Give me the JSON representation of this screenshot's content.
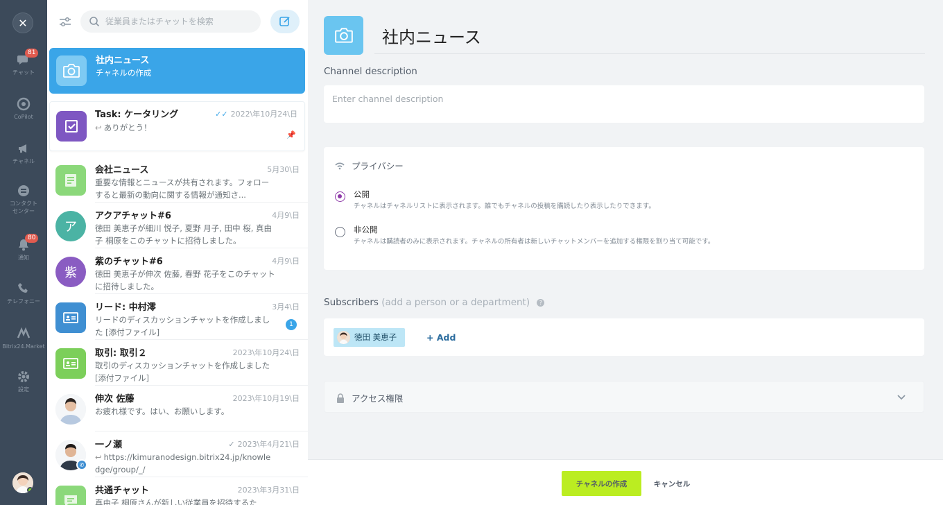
{
  "rail": {
    "items": [
      {
        "label": "チャット",
        "icon": "chat-icon",
        "badge": "81"
      },
      {
        "label": "CoPilot",
        "icon": "copilot-icon"
      },
      {
        "label": "チャネル",
        "icon": "megaphone-icon"
      },
      {
        "label": "コンタクト\nセンター",
        "icon": "contact-center-icon"
      },
      {
        "label": "通知",
        "icon": "bell-icon",
        "badge": "80"
      },
      {
        "label": "テレフォニー",
        "icon": "phone-icon"
      },
      {
        "label": "Bitrix24.Market",
        "icon": "market-icon"
      },
      {
        "label": "設定",
        "icon": "gear-icon"
      }
    ]
  },
  "search": {
    "placeholder": "従業員またはチャットを検索"
  },
  "chats": [
    {
      "title": "社内ニュース",
      "message": "チャネルの作成",
      "date": "",
      "avatar_color": "#7ecaf3"
    },
    {
      "title": "Task: ケータリング",
      "message": "ありがとう！",
      "date": "2022\\年10月24\\日",
      "avatar_color": "#7e57c2"
    },
    {
      "title": "会社ニュース",
      "message": "重要な情報とニュースが共有されます。フォローすると最新の動向に関する情報が通知さ...",
      "date": "5月30\\日",
      "avatar_color": "#8bd87a"
    },
    {
      "title": "アクアチャット#6",
      "message": "徳田 美恵子が細川 悦子, 夏野 月子, 田中 桜, 真由子 桐原をこのチャットに招待しました。",
      "date": "4月9\\日",
      "avatar_color": "#4bb3a4",
      "avatar_text": "ア"
    },
    {
      "title": "紫のチャット#6",
      "message": "徳田 美恵子が伸次 佐藤, 春野 花子をこのチャットに招待しました。",
      "date": "4月9\\日",
      "avatar_color": "#8a5cc2",
      "avatar_text": "紫"
    },
    {
      "title": "リード: 中村澪",
      "message": "リードのディスカッションチャットを作成しました [添付ファイル]",
      "date": "3月4\\日",
      "avatar_color": "#3f8fd2",
      "unread": "1"
    },
    {
      "title": "取引: 取引２",
      "message": "取引のディスカッションチャットを作成しました [添付ファイル]",
      "date": "2023\\年10月24\\日",
      "avatar_color": "#7ccf5a"
    },
    {
      "title": "伸次 佐藤",
      "message": "お疲れ様です。はい、お願いします。",
      "date": "2023\\年10月19\\日",
      "avatar_color": "#d7dde3"
    },
    {
      "title": "一ノ瀬",
      "message": "https://kimuranodesign.bitrix24.jp/knowledge/group/_/",
      "date": "2023\\年4月21\\日",
      "avatar_color": "#d7dde3"
    },
    {
      "title": "共通チャット",
      "message": "真由子 桐原さんが新しい従業員を招待するた",
      "date": "2023\\年3月31\\日",
      "avatar_color": "#8bd87a"
    }
  ],
  "channel": {
    "title": "社内ニュース",
    "description_label": "Channel description",
    "description_placeholder": "Enter channel description"
  },
  "privacy": {
    "title": "プライバシー",
    "options": [
      {
        "label": "公開",
        "desc": "チャネルはチャネルリストに表示されます。誰でもチャネルの投稿を購読したり表示したりできます。",
        "selected": true
      },
      {
        "label": "非公開",
        "desc": "チャネルは購読者のみに表示されます。チャネルの所有者は新しいチャットメンバーを追加する権限を割り当て可能です。",
        "selected": false
      }
    ]
  },
  "subscribers": {
    "label": "Subscribers",
    "hint": "(add a person or a department)",
    "help": "?",
    "chip": "徳田 美恵子",
    "add": "+ Add"
  },
  "access": {
    "title": "アクセス権限"
  },
  "footer": {
    "create": "チャネルの作成",
    "cancel": "キャンセル"
  },
  "colors": {
    "accent": "#3aa5e8",
    "create_button": "#bbed21",
    "radio": "#8e3aa8",
    "rail": "#3c4a5a"
  }
}
